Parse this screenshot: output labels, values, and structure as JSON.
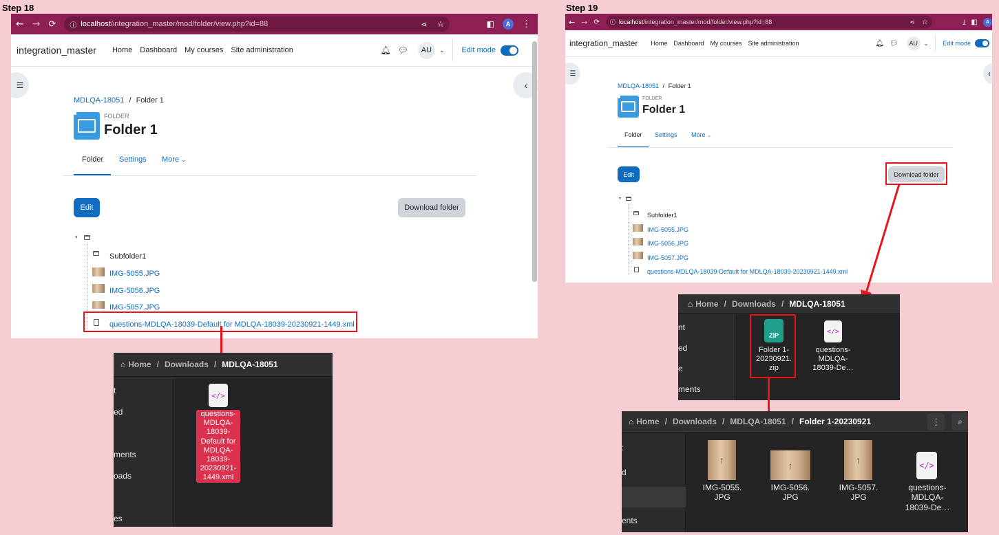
{
  "steps": {
    "left": "Step 18",
    "right": "Step 19"
  },
  "browser": {
    "url_host": "localhost",
    "url_path": "/integration_master/mod/folder/view.php?id=88",
    "profile_initial": "A"
  },
  "moodle": {
    "site_name": "integration_master",
    "nav": {
      "home": "Home",
      "dashboard": "Dashboard",
      "my_courses": "My courses",
      "site_admin": "Site administration"
    },
    "user_initials": "AU",
    "edit_mode": "Edit mode",
    "breadcrumb": {
      "course": "MDLQA-18051",
      "sep": "/",
      "current": "Folder 1"
    },
    "folder_kind": "FOLDER",
    "folder_title": "Folder 1",
    "tabs": {
      "folder": "Folder",
      "settings": "Settings",
      "more": "More"
    },
    "edit_button": "Edit",
    "download_button": "Download folder",
    "tree": {
      "subfolder": "Subfolder1",
      "files": [
        "IMG-5055.JPG",
        "IMG-5056.JPG",
        "IMG-5057.JPG",
        "questions-MDLQA-18039-Default for MDLQA-18039-20230921-1449.xml"
      ]
    }
  },
  "fm_step18": {
    "crumb_home": "Home",
    "crumb_downloads": "Downloads",
    "crumb_current": "MDLQA-18051",
    "sidebar": [
      "t",
      "ed",
      "ments",
      "oads",
      "es"
    ],
    "file_label": "questions-\nMDLQA-\n18039-\nDefault for\nMDLQA-\n18039-\n20230921-\n1449.xml"
  },
  "fm_step19a": {
    "crumb_home": "Home",
    "crumb_downloads": "Downloads",
    "crumb_current": "MDLQA-18051",
    "sidebar": [
      "nt",
      "ed",
      "e",
      "ments"
    ],
    "zip_label": "Folder 1-\n20230921.\nzip",
    "xml_label": "questions-\nMDLQA-\n18039-De…",
    "zip_badge": "ZIP"
  },
  "fm_step19b": {
    "crumb_home": "Home",
    "crumb_downloads": "Downloads",
    "crumb_mdl": "MDLQA-18051",
    "crumb_current": "Folder 1-20230921",
    "sidebar": [
      ":",
      "d",
      "ents"
    ],
    "files": [
      "IMG-5055.\nJPG",
      "IMG-5056.\nJPG",
      "IMG-5057.\nJPG",
      "questions-\nMDLQA-\n18039-De…"
    ]
  },
  "colors": {
    "chrome": "#8d1f55",
    "moodle_blue": "#0f6cbf",
    "highlight": "#e8141a",
    "bg": "#f5cdd2"
  }
}
